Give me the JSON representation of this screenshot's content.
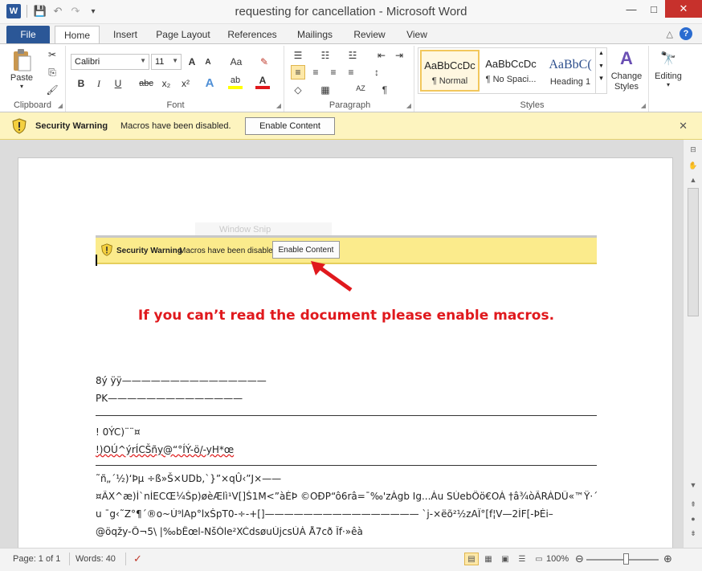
{
  "window": {
    "title": "requesting for cancellation - Microsoft Word",
    "minimize_glyph": "—",
    "maximize_glyph": "□",
    "close_glyph": "✕"
  },
  "qat": {
    "word_icon": "W",
    "save_glyph": "💾",
    "undo_glyph": "↶",
    "redo_glyph": "↷",
    "customize_glyph": "▾"
  },
  "tabs": [
    "File",
    "Home",
    "Insert",
    "Page Layout",
    "References",
    "Mailings",
    "Review",
    "View"
  ],
  "tabs_right": {
    "collapse_glyph": "△",
    "help_glyph": "?"
  },
  "ribbon": {
    "clipboard": {
      "label": "Clipboard",
      "paste": "Paste",
      "paste_arrow": "▾",
      "cut_glyph": "✂",
      "copy_glyph": "⎘",
      "format_painter_glyph": "🖌"
    },
    "font": {
      "label": "Font",
      "font_name": "Calibri",
      "font_size": "11",
      "grow": "A",
      "shrink": "A",
      "change_case": "Aa",
      "clear_format": "✎",
      "bold": "B",
      "italic": "I",
      "underline": "U",
      "strike": "abc",
      "subscript": "x₂",
      "superscript": "x²",
      "text_effects": "A",
      "highlight": "ab",
      "font_color": "A",
      "highlight_color": "#ffff00",
      "font_color_bar": "#e0191d"
    },
    "paragraph": {
      "label": "Paragraph",
      "bullets": "☰",
      "numbering": "☷",
      "multilevel": "☳",
      "dec_indent": "⇤",
      "inc_indent": "⇥",
      "align_left": "≡",
      "align_center": "≡",
      "align_right": "≡",
      "justify": "≡",
      "line_spacing": "↕",
      "shading": "◇",
      "borders": "▦",
      "sort": "↓",
      "show_marks": "¶",
      "sort_label": "AZ"
    },
    "styles": {
      "label": "Styles",
      "items": [
        {
          "sample": "AaBbCcDc",
          "name": "¶ Normal"
        },
        {
          "sample": "AaBbCcDc",
          "name": "¶ No Spaci..."
        },
        {
          "sample": "AaBbC(",
          "name": "Heading 1"
        }
      ],
      "change_styles": "Change Styles",
      "change_styles_arrow": "▾",
      "scroll_up": "▲",
      "scroll_down": "▼",
      "more": "▾"
    },
    "editing": {
      "label": "Editing",
      "arrow": "▾"
    }
  },
  "security_bar": {
    "title": "Security Warning",
    "message": "Macros have been disabled.",
    "button": "Enable Content",
    "close": "✕"
  },
  "document": {
    "embedded_watermark": "Window Snip",
    "embedded_bar": {
      "title": "Security Warning",
      "message": "Macros have been disabled.",
      "button": "Enable Content"
    },
    "lure_text": "If you can’t read the document please enable macros.",
    "lines": [
      "8ý  ÿÿ———————————————",
      "PK——————————————",
      "! 0ÝC)¨¨¤",
      "!)OÚ^ýrÍCŠñy@“°ÍÝ-ö/-yH*œ",
      "˜ñ„´½)‘Þµ  ÷ß»Š×UDb,`}”×qÛ‹”J×——",
      "¤ÃX^æ)Ì`nÌECŒ¼Šp)øèÆlì¹V[]Š1M<”àÈÞ   ©OÐP“ô6râ=¯‰'zÀgb Ig...Áu     SÙebÖö€OÀ   †â¾òÃRÁDÛ«™Ÿ·´q",
      "u            ¯g‹˜Z°¶´®o~Ù⁹lAp°lxŠpT0-÷-+[]———————————————— `j-×ëõ²½zAÏ°[f¦V—2ÍF[-ÞÉi–",
      "@öqžy-Õ¬5\\ |‰bÊœl-NšÓle²XĆdsøuÚjcsÙÁ  Å7cð   Îf·»êà"
    ]
  },
  "statusbar": {
    "page": "Page: 1 of 1",
    "words": "Words: 40",
    "proof_glyph": "✓",
    "views": [
      "▤",
      "▦",
      "▣",
      "☰",
      "▭"
    ],
    "zoom": "100%",
    "zoom_out": "⊖",
    "zoom_in": "⊕",
    "zoom_value": 100
  },
  "scrollbar": {
    "up": "▲",
    "down": "▼",
    "prev_page": "⇞",
    "next_page": "⇟",
    "select_browse": "●"
  },
  "ruler_icons": {
    "view_ruler": "⊟",
    "pan": "✋"
  }
}
